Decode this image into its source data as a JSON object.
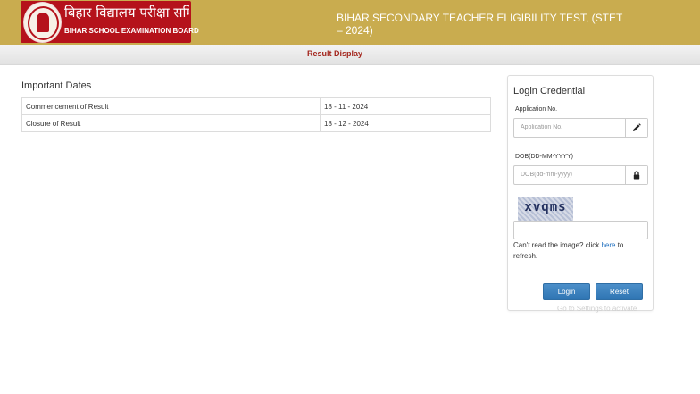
{
  "header": {
    "org_name_hindi": "बिहार विद्यालय परीक्षा समिति",
    "org_name_english": "BIHAR SCHOOL EXAMINATION BOARD",
    "title": "BIHAR SECONDARY TEACHER ELIGIBILITY TEST, (STET – 2024)",
    "background_color": "#c9ac4f",
    "logo_color": "#b5121b"
  },
  "nav": {
    "result_display": "Result Display",
    "link_color": "#a3251c"
  },
  "important_dates": {
    "title": "Important Dates",
    "rows": [
      {
        "event": "Commencement of Result",
        "date": "18 - 11 - 2024"
      },
      {
        "event": "Closure of Result",
        "date": "18 - 12 - 2024"
      }
    ]
  },
  "login": {
    "title": "Login Credential",
    "application_label": "Application No.",
    "application_placeholder": "Application No.",
    "application_icon": "pencil-icon",
    "dob_label": "DOB(DD-MM-YYYY)",
    "dob_placeholder": "DOB(dd-mm-yyyy)",
    "dob_icon": "lock-icon",
    "captcha_text": "xvqms",
    "refresh_prefix": "Can't read the image? click ",
    "refresh_link": "here",
    "refresh_suffix": " to refresh.",
    "login_button": "Login",
    "reset_button": "Reset",
    "button_color": "#337ab7"
  },
  "watermark": {
    "text": "Go to Settings to activate"
  }
}
